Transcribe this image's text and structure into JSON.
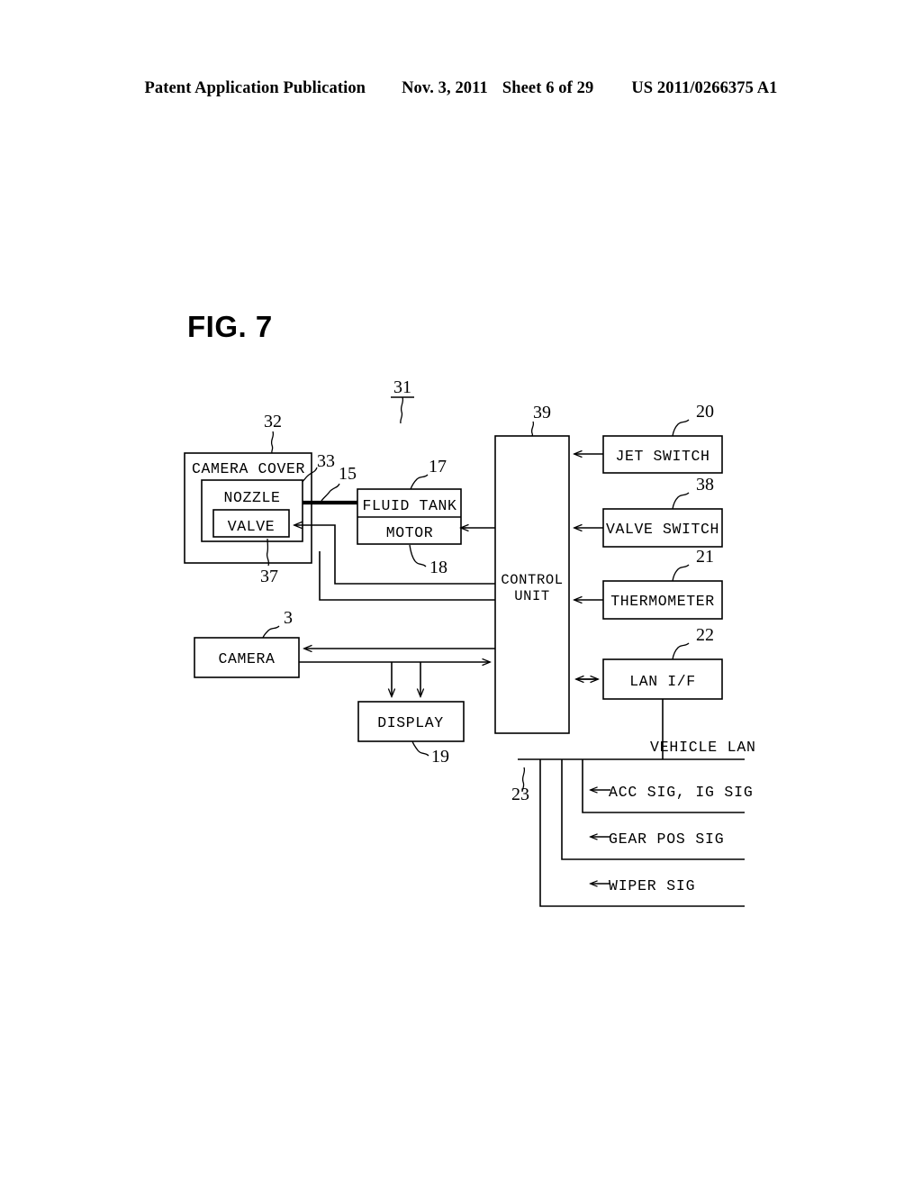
{
  "header": {
    "publication": "Patent Application Publication",
    "date": "Nov. 3, 2011",
    "sheet": "Sheet 6 of 29",
    "patent_number": "US 2011/0266375 A1"
  },
  "figure": {
    "label": "FIG. 7",
    "system_ref": "31"
  },
  "blocks": [
    {
      "id": "camera-cover",
      "label": "CAMERA COVER",
      "ref": "32"
    },
    {
      "id": "nozzle",
      "label": "NOZZLE",
      "ref": "33"
    },
    {
      "id": "valve",
      "label": "VALVE",
      "ref": "37"
    },
    {
      "id": "fluid-tank",
      "label": "FLUID TANK",
      "ref": "17"
    },
    {
      "id": "motor",
      "label": "MOTOR",
      "ref": "18"
    },
    {
      "id": "control-unit",
      "label_line1": "CONTROL",
      "label_line2": "UNIT",
      "ref": "39"
    },
    {
      "id": "jet-switch",
      "label": "JET SWITCH",
      "ref": "20"
    },
    {
      "id": "valve-switch",
      "label": "VALVE SWITCH",
      "ref": "38"
    },
    {
      "id": "thermometer",
      "label": "THERMOMETER",
      "ref": "21"
    },
    {
      "id": "lan-if",
      "label": "LAN I/F",
      "ref": "22"
    },
    {
      "id": "camera",
      "label": "CAMERA",
      "ref": "3"
    },
    {
      "id": "display",
      "label": "DISPLAY",
      "ref": "19"
    }
  ],
  "labels": {
    "fluid_line_ref": "15",
    "vehicle_lan": "VEHICLE LAN",
    "bus_ref": "23"
  },
  "signals": [
    {
      "arrow": "←",
      "text": "ACC SIG, IG SIG"
    },
    {
      "arrow": "←",
      "text": "GEAR POS SIG"
    },
    {
      "arrow": "←",
      "text": "WIPER SIG"
    }
  ],
  "colors": {
    "ink": "#000000",
    "paper": "#ffffff"
  }
}
